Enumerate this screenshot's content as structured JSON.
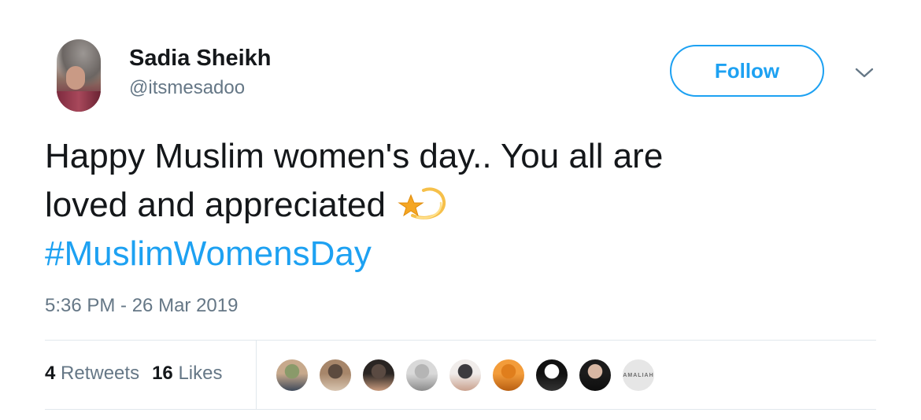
{
  "user": {
    "display_name": "Sadia Sheikh",
    "handle": "@itsmesadoo"
  },
  "header": {
    "follow_label": "Follow"
  },
  "tweet": {
    "text_line1": "Happy Muslim women's day.. You all are",
    "text_line2": "loved and appreciated",
    "emoji": "dizzy-shooting-star-emoji",
    "hashtag": "#MuslimWomensDay",
    "timestamp": "5:36 PM - 26 Mar 2019"
  },
  "stats": {
    "retweets_count": "4",
    "retweets_label": "Retweets",
    "likes_count": "16",
    "likes_label": "Likes"
  },
  "likers": [
    {
      "name": "liker-avatar-1",
      "colors": [
        "#c7a98c",
        "#8a9a6a",
        "#3f4a5a"
      ]
    },
    {
      "name": "liker-avatar-2",
      "colors": [
        "#a7866a",
        "#5c4a3e",
        "#d8c5b0"
      ]
    },
    {
      "name": "liker-avatar-3",
      "colors": [
        "#2a2523",
        "#5a4a42",
        "#c99b7e"
      ]
    },
    {
      "name": "liker-avatar-4",
      "colors": [
        "#d9d9d9",
        "#b5b5b5",
        "#8b8b8b"
      ]
    },
    {
      "name": "liker-avatar-5",
      "colors": [
        "#f0ecea",
        "#3c3b3f",
        "#c9a08d"
      ]
    },
    {
      "name": "liker-avatar-6",
      "colors": [
        "#f39c3a",
        "#e07e1c",
        "#b85f12"
      ]
    },
    {
      "name": "liker-avatar-7",
      "colors": [
        "#111111",
        "#ffffff",
        "#333333"
      ]
    },
    {
      "name": "liker-avatar-8",
      "colors": [
        "#1b1b1b",
        "#d8b7a3",
        "#0e0e0e"
      ]
    },
    {
      "name": "liker-avatar-9",
      "text": "AMALIAH"
    }
  ],
  "colors": {
    "accent": "#1da1f2",
    "text": "#14171a",
    "muted": "#657786",
    "divider": "#e1e8ed"
  }
}
